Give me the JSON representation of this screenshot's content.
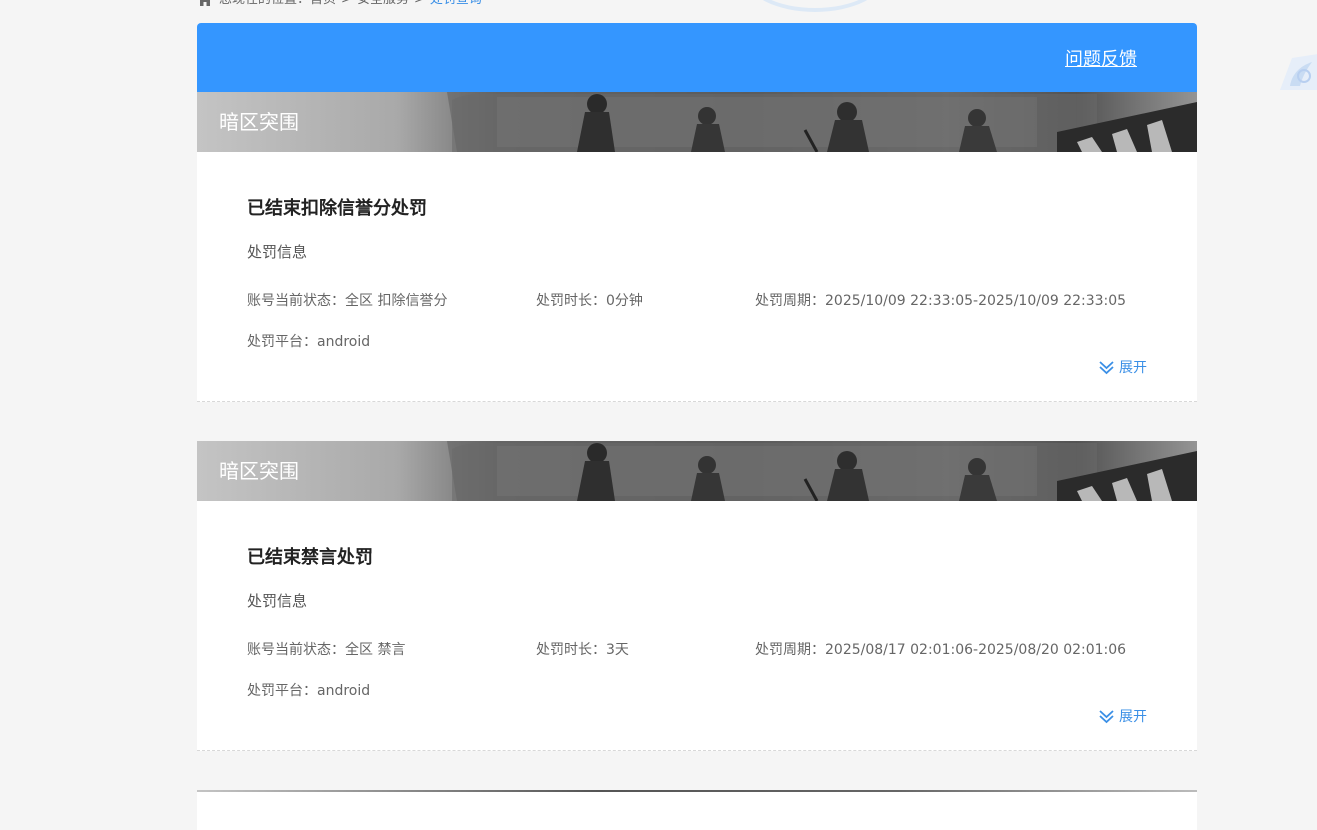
{
  "breadcrumb": {
    "prefix": "您现在的位置：",
    "home": "首页",
    "sep1": ">",
    "section": "安全服务",
    "sep2": ">",
    "current": "处罚查询"
  },
  "header": {
    "feedback_label": "问题反馈",
    "accent_color": "#3496ff"
  },
  "records": [
    {
      "game": "暗区突围",
      "status_title": "已结束扣除信誉分处罚",
      "section_label": "处罚信息",
      "account_status": "账号当前状态：全区 扣除信誉分",
      "duration": "处罚时长：0分钟",
      "period": "处罚周期：2025/10/09 22:33:05-2025/10/09 22:33:05",
      "platform": "处罚平台：android",
      "expand_label": "展开"
    },
    {
      "game": "暗区突围",
      "status_title": "已结束禁言处罚",
      "section_label": "处罚信息",
      "account_status": "账号当前状态：全区 禁言",
      "duration": "处罚时长：3天",
      "period": "处罚周期：2025/08/17 02:01:06-2025/08/20 02:01:06",
      "platform": "处罚平台：android",
      "expand_label": "展开"
    }
  ],
  "icons": {
    "home": "home-icon",
    "expand": "double-chevron-down-icon"
  }
}
